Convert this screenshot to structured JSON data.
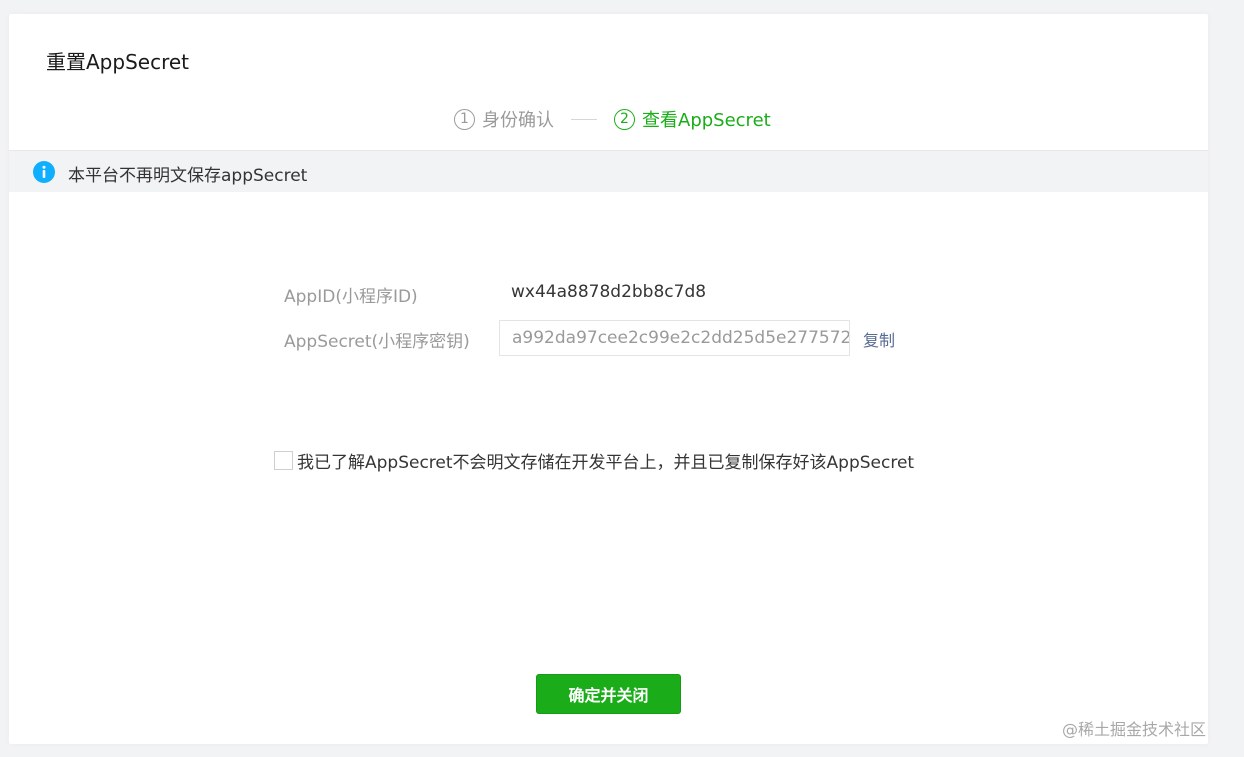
{
  "dialog": {
    "title": "重置AppSecret"
  },
  "steps": [
    {
      "number": "1",
      "label": "身份确认",
      "state": "done"
    },
    {
      "number": "2",
      "label": "查看AppSecret",
      "state": "active"
    }
  ],
  "notice": {
    "icon": "info-icon",
    "text": "本平台不再明文保存appSecret"
  },
  "fields": {
    "appid_label": "AppID(小程序ID)",
    "appid_value": "wx44a8878d2bb8c7d8",
    "appsecret_label": "AppSecret(小程序密钥)",
    "appsecret_value": "a992da97cee2c99e2c2dd25d5e277572",
    "copy_label": "复制"
  },
  "acknowledge": {
    "checked": false,
    "text": "我已了解AppSecret不会明文存储在开发平台上，并且已复制保存好该AppSecret"
  },
  "confirm_button": {
    "label": "确定并关闭"
  },
  "watermark": {
    "text": "@稀土掘金技术社区"
  },
  "colors": {
    "accent": "#1aad19",
    "link": "#576b95",
    "info": "#10aeff"
  }
}
